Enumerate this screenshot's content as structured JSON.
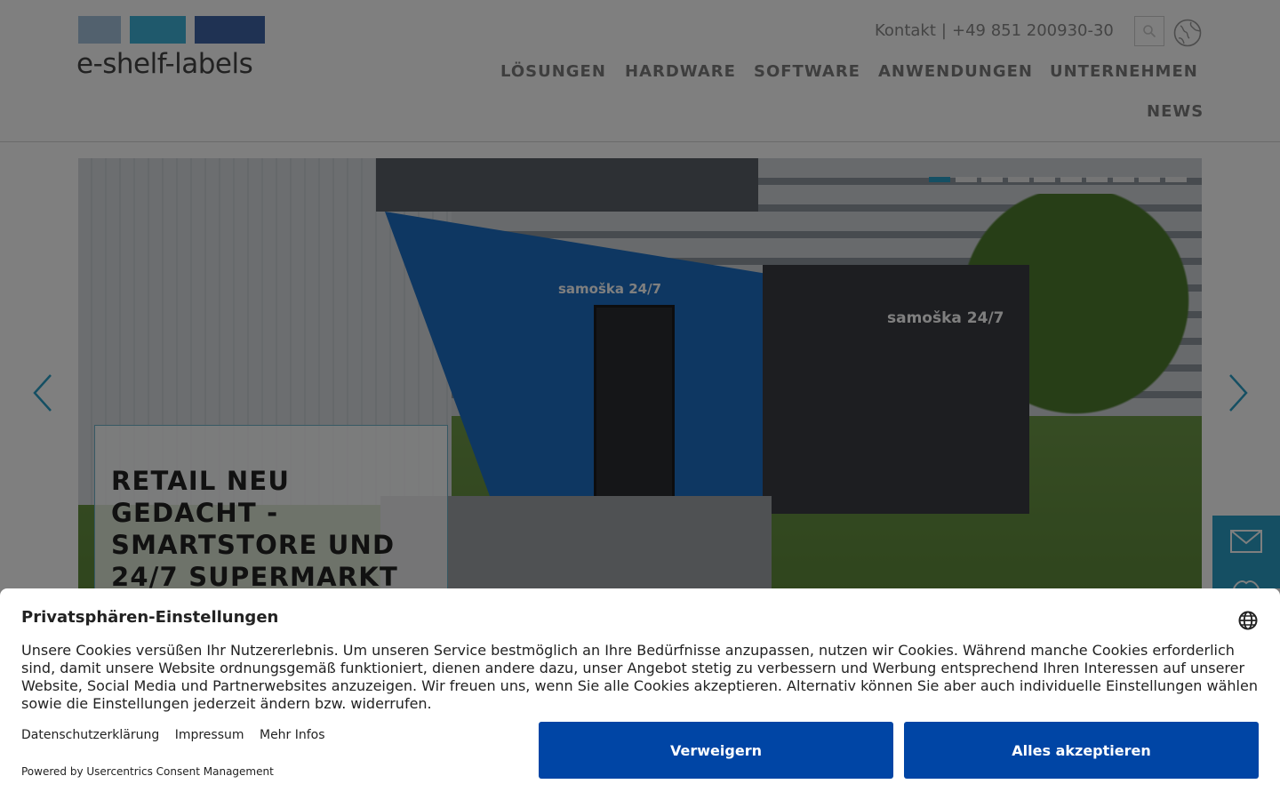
{
  "brand": {
    "name": "e-shelf-labels",
    "colors": {
      "light_blue": "#a4c3dd",
      "cyan": "#3fb2d8",
      "dark_blue": "#3f64a7"
    }
  },
  "header": {
    "contact_label": "Kontakt",
    "separator": "|",
    "phone": "+49 851 200930-30",
    "search_icon": "search-icon",
    "language_icon": "globe-icon"
  },
  "nav": {
    "items": [
      {
        "label": "LÖSUNGEN"
      },
      {
        "label": "HARDWARE"
      },
      {
        "label": "SOFTWARE"
      },
      {
        "label": "ANWENDUNGEN"
      },
      {
        "label": "UNTERNEHMEN"
      },
      {
        "label": "NEWS"
      }
    ]
  },
  "slider": {
    "caption": "RETAIL NEU GEDACHT - SMARTSTORE UND 24/7 SUPERMARKT",
    "slide_count": 10,
    "active_slide": 1,
    "photo_signs": [
      "samoška 24/7",
      "samoška 24/7"
    ],
    "prev_icon": "chevron-left-icon",
    "next_icon": "chevron-right-icon",
    "accent": "#2aa0c8"
  },
  "side_contact": {
    "icons": [
      "mail-icon",
      "handshake-icon"
    ]
  },
  "consent": {
    "title": "Privatsphären-Einstellungen",
    "body": "Unsere Cookies versüßen Ihr Nutzererlebnis. Um unseren Service bestmöglich an Ihre Bedürfnisse anzupassen, nutzen wir Cookies. Während manche Cookies erforderlich sind, damit unsere Website ordnungsgemäß funktioniert, dienen andere dazu, unser Angebot stetig zu verbessern und Werbung entsprechend Ihren Interessen auf unserer Website, Social Media und Partnerwebsites anzuzeigen. Wir freuen uns, wenn Sie alle Cookies akzeptieren. Alternativ können Sie aber auch individuelle Einstellungen wählen sowie die Einstellungen jederzeit ändern bzw. widerrufen.",
    "links": [
      "Datenschutzerklärung",
      "Impressum",
      "Mehr Infos"
    ],
    "powered_by": "Powered by Usercentrics Consent Management",
    "deny_label": "Verweigern",
    "accept_label": "Alles akzeptieren",
    "button_color": "#0045a5"
  }
}
